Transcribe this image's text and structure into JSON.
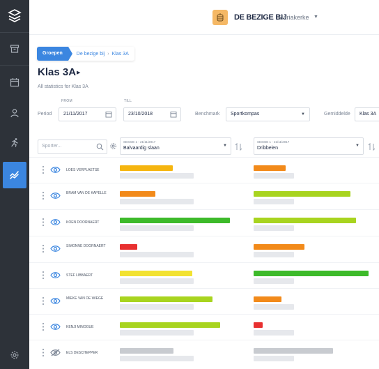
{
  "app": {
    "school_name": "DE BEZIGE BIJ",
    "school_location": "Mariakerke"
  },
  "sidebar": {
    "items": [
      {
        "icon": "archive-icon",
        "active": false
      },
      {
        "icon": "calendar-icon",
        "active": false
      },
      {
        "icon": "person-icon",
        "active": false
      },
      {
        "icon": "runner-icon",
        "active": false
      },
      {
        "icon": "stats-chart-icon",
        "active": true
      }
    ],
    "bottom_icon": "settings-gear-icon"
  },
  "breadcrumb": {
    "root": "Groepen",
    "parent": "De bezige bij",
    "separator": "›",
    "current": "Klas 3A"
  },
  "page": {
    "title": "Klas 3A",
    "subtitle": "All statistics for Klas 3A"
  },
  "filters": {
    "period_label": "Period",
    "from_label": "FROM",
    "from_value": "21/11/2017",
    "till_label": "TILL",
    "till_value": "23/10/2018",
    "benchmark_label": "Benchmark",
    "benchmark_value": "Sportkompas",
    "average_label": "Gemiddelde",
    "average_value": "Klas 3A"
  },
  "table": {
    "search_placeholder": "Sporter...",
    "columns": [
      {
        "session": "SESSIE 1 - 21/11/2017",
        "skill": "Balvaardig slaan"
      },
      {
        "session": "SESSIE 1 - 21/11/2017",
        "skill": "Dribbelen"
      }
    ],
    "rows": [
      {
        "name": "LOES VERPLAETSE",
        "visible": true,
        "bars": [
          {
            "value": 0.48,
            "color": "#f5b50f"
          },
          {
            "value": 0.28,
            "color": "#f28a1a"
          }
        ]
      },
      {
        "name": "BRAM VAN DE KAPELLE",
        "visible": true,
        "bars": [
          {
            "value": 0.32,
            "color": "#f28a1a"
          },
          {
            "value": 0.84,
            "color": "#a8d41f"
          }
        ]
      },
      {
        "name": "KOEN DOORNAERT",
        "visible": true,
        "bars": [
          {
            "value": 1.0,
            "color": "#3dba2a"
          },
          {
            "value": 0.89,
            "color": "#a8d41f"
          }
        ]
      },
      {
        "name": "SIMONNE DOORNAERT",
        "visible": true,
        "bars": [
          {
            "value": 0.16,
            "color": "#e83030"
          },
          {
            "value": 0.44,
            "color": "#f28a1a"
          }
        ]
      },
      {
        "name": "STEF LIBBAERT",
        "visible": true,
        "bars": [
          {
            "value": 0.66,
            "color": "#f2e231"
          },
          {
            "value": 1.0,
            "color": "#3dba2a"
          }
        ]
      },
      {
        "name": "MIEKE VAN DE WIEGE",
        "visible": true,
        "bars": [
          {
            "value": 0.84,
            "color": "#a8d41f"
          },
          {
            "value": 0.24,
            "color": "#f28a1a"
          }
        ]
      },
      {
        "name": "KENJI MINOGUE",
        "visible": true,
        "bars": [
          {
            "value": 0.91,
            "color": "#a8d41f"
          },
          {
            "value": 0.08,
            "color": "#e83030"
          }
        ]
      },
      {
        "name": "ELS DESCHEPPER",
        "visible": false,
        "bars": [
          {
            "value": 0.49,
            "color": "#c8cbd0"
          },
          {
            "value": 0.69,
            "color": "#c8cbd0"
          }
        ]
      }
    ]
  }
}
